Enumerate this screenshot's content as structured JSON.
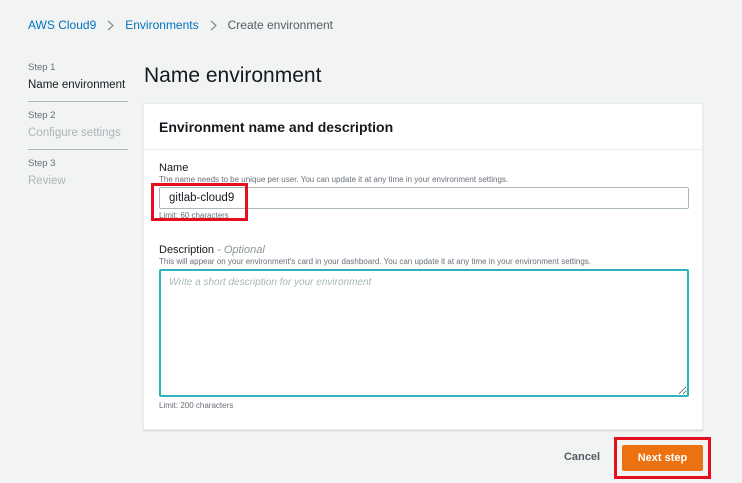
{
  "breadcrumb": {
    "items": [
      "AWS Cloud9",
      "Environments"
    ],
    "current": "Create environment"
  },
  "steps": [
    {
      "number": "Step 1",
      "title": "Name environment",
      "state": "active"
    },
    {
      "number": "Step 2",
      "title": "Configure settings",
      "state": "inactive"
    },
    {
      "number": "Step 3",
      "title": "Review",
      "state": "inactive"
    }
  ],
  "page_title": "Name environment",
  "panel": {
    "title": "Environment name and description",
    "name_field": {
      "label": "Name",
      "hint": "The name needs to be unique per user. You can update it at any time in your environment settings.",
      "value": "gitlab-cloud9",
      "limit": "Limit: 60 characters"
    },
    "description_field": {
      "label": "Description",
      "optional": "- Optional",
      "hint": "This will appear on your environment's card in your dashboard. You can update it at any time in your environment settings.",
      "placeholder": "Write a short description for your environment",
      "limit": "Limit: 200 characters"
    }
  },
  "actions": {
    "cancel_label": "Cancel",
    "next_label": "Next step"
  },
  "colors": {
    "primary_button": "#ec7211",
    "link": "#0073bb",
    "focus_border": "#2eb3ba",
    "annotation_highlight": "#e40e1d"
  }
}
